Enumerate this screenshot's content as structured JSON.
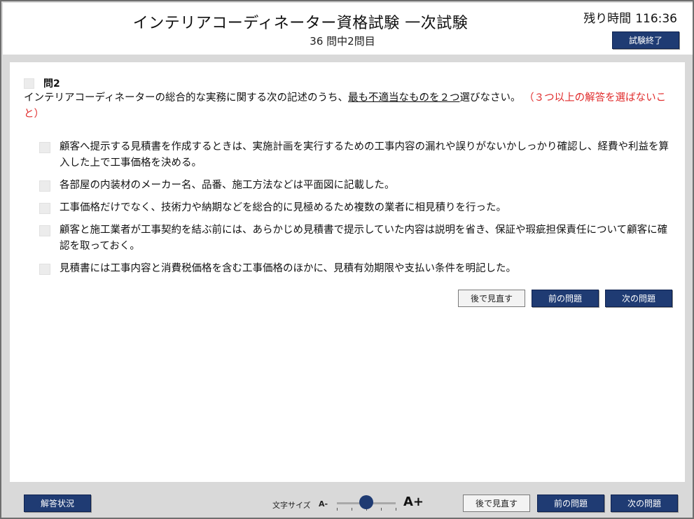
{
  "header": {
    "title": "インテリアコーディネーター資格試験 一次試験",
    "progress": "36 問中2問目",
    "timer_label": "残り時間",
    "timer_value": "116:36",
    "end_button": "試験終了"
  },
  "question": {
    "number": "問2",
    "text_part1": "インテリアコーディネーターの総合的な実務に関する次の記述のうち、",
    "text_underlined": "最も不適当なものを２つ",
    "text_part2": "選びなさい。",
    "warning": "（３つ以上の解答を選ばないこと）",
    "options": [
      "顧客へ提示する見積書を作成するときは、実施計画を実行するための工事内容の漏れや誤りがないかしっかり確認し、経費や利益を算入した上で工事価格を決める。",
      "各部屋の内装材のメーカー名、品番、施工方法などは平面図に記載した。",
      "工事価格だけでなく、技術力や納期などを総合的に見極めるため複数の業者に相見積りを行った。",
      "顧客と施工業者が工事契約を結ぶ前には、あらかじめ見積書で提示していた内容は説明を省き、保証や瑕疵担保責任について顧客に確認を取っておく。",
      "見積書には工事内容と消費税価格を含む工事価格のほかに、見積有効期限や支払い条件を明記した。"
    ]
  },
  "main_buttons": {
    "review_later": "後で見直す",
    "prev": "前の問題",
    "next": "次の問題"
  },
  "footer": {
    "answer_status": "解答状況",
    "font_size_label": "文字サイズ",
    "font_minus": "A-",
    "font_plus": "A+",
    "review_later": "後で見直す",
    "prev": "前の問題",
    "next": "次の問題"
  },
  "colors": {
    "primary_button": "#1f3b73",
    "warning_text": "#e02b2b",
    "background": "#d9d9d9"
  }
}
